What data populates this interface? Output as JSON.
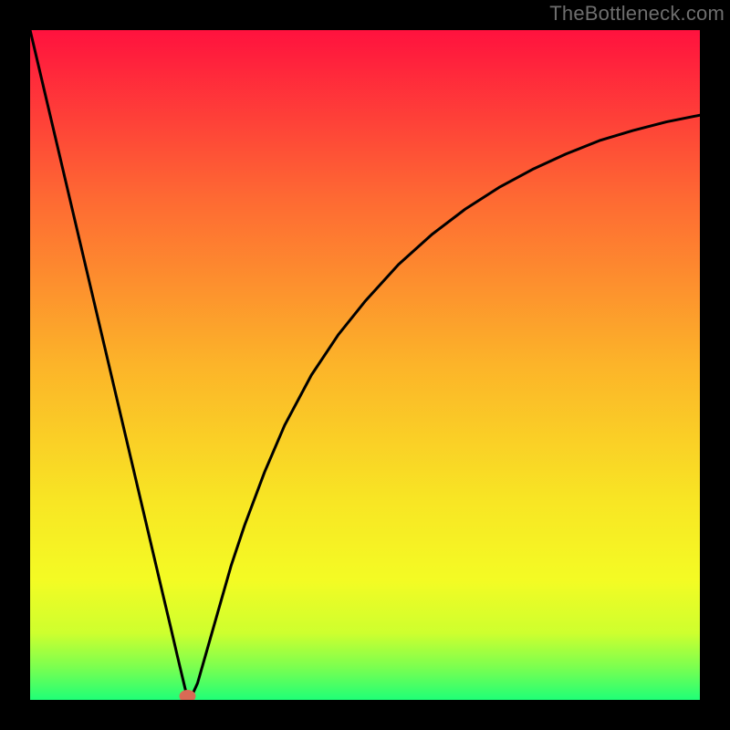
{
  "watermark": "TheBottleneck.com",
  "chart_data": {
    "type": "line",
    "title": "",
    "xlabel": "",
    "ylabel": "",
    "xlim": [
      0,
      100
    ],
    "ylim": [
      0,
      100
    ],
    "grid": false,
    "series": [
      {
        "name": "curve",
        "x": [
          0,
          2,
          4,
          6,
          8,
          10,
          12,
          14,
          16,
          18,
          20,
          21,
          22,
          23,
          23.5,
          24,
          25,
          26,
          28,
          30,
          32,
          35,
          38,
          42,
          46,
          50,
          55,
          60,
          65,
          70,
          75,
          80,
          85,
          90,
          95,
          100
        ],
        "values": [
          100,
          91.5,
          83,
          74.5,
          66,
          57.5,
          49,
          40.5,
          32,
          23.5,
          15,
          10.8,
          6.5,
          2.3,
          0.2,
          0.3,
          2.5,
          6,
          13,
          20,
          26,
          34,
          41,
          48.5,
          54.5,
          59.5,
          65,
          69.5,
          73.3,
          76.5,
          79.2,
          81.5,
          83.5,
          85,
          86.3,
          87.3
        ]
      }
    ],
    "marker": {
      "x": 23.5,
      "y": 0,
      "color": "#d96a55"
    },
    "background_gradient": {
      "stops": [
        {
          "offset": 0.0,
          "color": "#ff123e"
        },
        {
          "offset": 0.25,
          "color": "#fe6933"
        },
        {
          "offset": 0.5,
          "color": "#fcb429"
        },
        {
          "offset": 0.7,
          "color": "#f8e524"
        },
        {
          "offset": 0.82,
          "color": "#f4fb24"
        },
        {
          "offset": 0.9,
          "color": "#ceff2e"
        },
        {
          "offset": 0.95,
          "color": "#7dff4f"
        },
        {
          "offset": 1.0,
          "color": "#1fff77"
        }
      ]
    },
    "curve_color": "#000000",
    "curve_width": 3
  }
}
